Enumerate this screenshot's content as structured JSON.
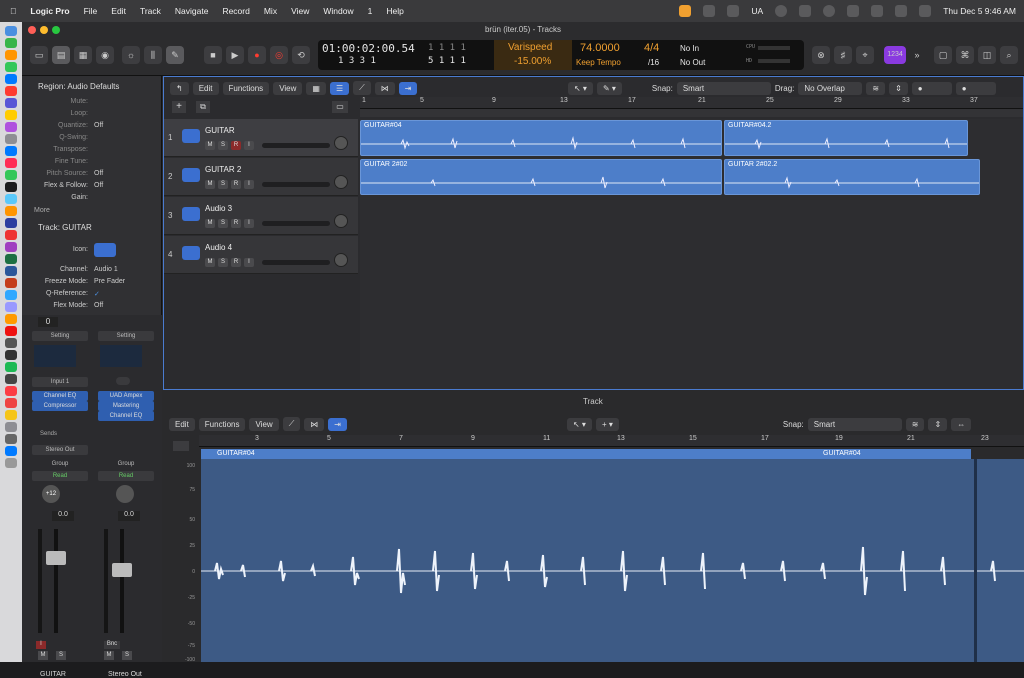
{
  "menubar": {
    "items": [
      "Logic Pro",
      "File",
      "Edit",
      "Track",
      "Navigate",
      "Record",
      "Mix",
      "View",
      "Window",
      "1",
      "Help"
    ],
    "right": {
      "user": "UA",
      "datetime": "Thu Dec 5  9:46 AM"
    }
  },
  "window": {
    "title": "brün (iter.05) - Tracks"
  },
  "lcd": {
    "time": "01:00:02:00.54",
    "time_sub": "1   3   3     1",
    "bars_top": "1   1   1   1",
    "bars_sub": "5   1   1   1",
    "varispeed_label": "Varispeed",
    "varispeed_value": "-15.00%",
    "tempo": "74.0000",
    "tempo_mode": "Keep Tempo",
    "sig_top": "4/4",
    "sig_bottom": "/16",
    "in": "No In",
    "out": "No Out",
    "cpu_label": "CPU",
    "hd_label": "HD"
  },
  "count_badge": "1234",
  "inspector": {
    "region_header": "Region: Audio Defaults",
    "region_rows": [
      {
        "k": "Mute:",
        "v": ""
      },
      {
        "k": "Loop:",
        "v": ""
      },
      {
        "k": "Quantize:",
        "v": "Off"
      },
      {
        "k": "Q-Swing:",
        "v": ""
      },
      {
        "k": "Transpose:",
        "v": ""
      },
      {
        "k": "Fine Tune:",
        "v": ""
      },
      {
        "k": "Pitch Source:",
        "v": "Off"
      },
      {
        "k": "Flex & Follow:",
        "v": "Off"
      },
      {
        "k": "Gain:",
        "v": ""
      }
    ],
    "more": "More",
    "track_header": "Track:  GUITAR",
    "track_rows": [
      {
        "k": "Icon:",
        "v": ""
      },
      {
        "k": "Channel:",
        "v": "Audio 1"
      },
      {
        "k": "Freeze Mode:",
        "v": "Pre Fader"
      },
      {
        "k": "Q-Reference:",
        "v": "✓"
      },
      {
        "k": "Flex Mode:",
        "v": "Off"
      }
    ]
  },
  "mixer": {
    "strip1": {
      "top_value": "0",
      "setting": "Setting",
      "input": "Input 1",
      "plugins": [
        "Channel EQ",
        "Compressor"
      ],
      "sends": "Sends",
      "output": "Stereo Out",
      "group": "Group",
      "auto": "Read",
      "pan": "+12",
      "vol": "0.0",
      "name": "GUITAR",
      "btn_i": "I",
      "mute": "M",
      "solo": "S"
    },
    "strip2": {
      "setting": "Setting",
      "plugins": [
        "UAD Ampex",
        "Mastering",
        "Channel EQ"
      ],
      "group": "Group",
      "auto": "Read",
      "vol": "0.0",
      "name": "Stereo Out",
      "bnc": "Bnc",
      "mute": "M",
      "solo": "S"
    }
  },
  "tracks_area": {
    "menus": [
      "Edit",
      "Functions",
      "View"
    ],
    "snap_label": "Snap:",
    "snap_value": "Smart",
    "drag_label": "Drag:",
    "drag_value": "No Overlap",
    "ruler": [
      "1",
      "5",
      "9",
      "13",
      "17",
      "21",
      "25",
      "29",
      "33",
      "37"
    ],
    "tracks": [
      {
        "num": "1",
        "name": "GUITAR"
      },
      {
        "num": "2",
        "name": "GUITAR 2"
      },
      {
        "num": "3",
        "name": "Audio 3"
      },
      {
        "num": "4",
        "name": "Audio 4"
      }
    ],
    "track_buttons": [
      "M",
      "S",
      "R",
      "I"
    ],
    "regions": [
      {
        "label": "GUITAR#04"
      },
      {
        "label": "GUITAR#04.2"
      },
      {
        "label": "GUITAR 2#02"
      },
      {
        "label": "GUITAR 2#02.2"
      }
    ]
  },
  "editor": {
    "title": "Track",
    "menus": [
      "Edit",
      "Functions",
      "View"
    ],
    "snap_label": "Snap:",
    "snap_value": "Smart",
    "ruler": [
      "3",
      "5",
      "7",
      "9",
      "11",
      "13",
      "15",
      "17",
      "19",
      "21",
      "23"
    ],
    "region_label": "GUITAR#04",
    "region_label2": "GUITAR#04",
    "y_axis": [
      "100",
      "75",
      "50",
      "25",
      "0",
      "-25",
      "-50",
      "-75",
      "-100"
    ]
  },
  "colors": {
    "accent": "#3b6fd0",
    "region": "#4d7ec9",
    "lcd_orange": "#f0a030"
  }
}
